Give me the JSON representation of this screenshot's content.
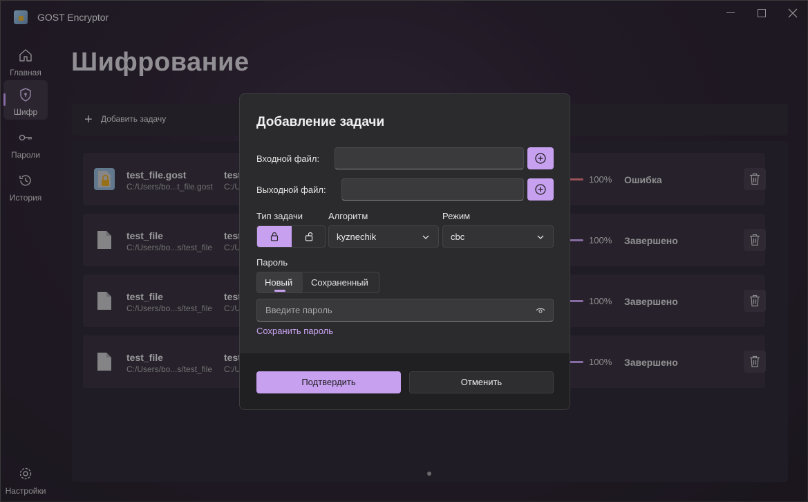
{
  "window": {
    "title": "GOST Encryptor"
  },
  "sidebar": {
    "items": [
      {
        "label": "Главная",
        "icon": "home-icon"
      },
      {
        "label": "Шифр",
        "icon": "shield-icon",
        "active": true
      },
      {
        "label": "Пароли",
        "icon": "key-icon"
      },
      {
        "label": "История",
        "icon": "history-icon"
      }
    ],
    "settings_label": "Настройки"
  },
  "page": {
    "title": "Шифрование"
  },
  "toolbar": {
    "add_task_label": "Добавить задачу"
  },
  "tasks": [
    {
      "name": "test_file.gost",
      "path": "C:/Users/bo...t_file.gost",
      "output_name": "test",
      "output_path": "C:/U",
      "progress": "100%",
      "progress_value": 1.0,
      "status": "Ошибка",
      "icon": "locked-file-icon"
    },
    {
      "name": "test_file",
      "path": "C:/Users/bo...s/test_file",
      "output_name": "test",
      "output_path": "C:/U",
      "progress": "100%",
      "progress_value": 1.0,
      "status": "Завершено",
      "icon": "file-icon"
    },
    {
      "name": "test_file",
      "path": "C:/Users/bo...s/test_file",
      "output_name": "test",
      "output_path": "C:/U",
      "progress": "100%",
      "progress_value": 1.0,
      "status": "Завершено",
      "icon": "file-icon"
    },
    {
      "name": "test_file",
      "path": "C:/Users/bo...s/test_file",
      "output_name": "test",
      "output_path": "C:/U",
      "progress": "100%",
      "progress_value": 1.0,
      "status": "Завершено",
      "icon": "file-icon"
    }
  ],
  "dialog": {
    "title": "Добавление задачи",
    "input_file_label": "Входной файл:",
    "input_file_value": "",
    "output_file_label": "Выходной файл:",
    "output_file_value": "",
    "task_type_label": "Тип задачи",
    "task_type_selected": "encrypt",
    "algorithm_label": "Алгоритм",
    "algorithm_value": "kyznechik",
    "mode_label": "Режим",
    "mode_value": "cbc",
    "password_label": "Пароль",
    "password_tabs": [
      "Новый",
      "Сохраненный"
    ],
    "password_placeholder": "Введите пароль",
    "save_password_link": "Сохранить пароль",
    "confirm_label": "Подтвердить",
    "cancel_label": "Отменить"
  },
  "colors": {
    "accent": "#c7a0f0",
    "error": "#e6787e"
  }
}
